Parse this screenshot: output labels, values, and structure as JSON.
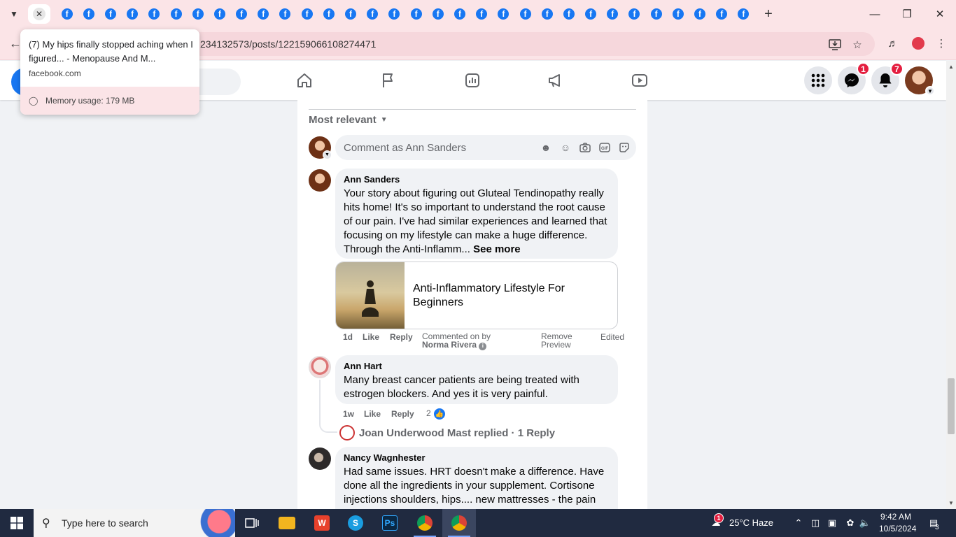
{
  "browser": {
    "tab_count_facebook": 32,
    "hovercard": {
      "title": "(7) My hips finally stopped aching when I figured... - Menopause And M...",
      "domain": "facebook.com",
      "memory": "Memory usage: 179 MB"
    },
    "url": "234132573/posts/122159066108274471"
  },
  "fb": {
    "messenger_badge": "1",
    "notifications_badge": "7"
  },
  "comments": {
    "sort_label": "Most relevant",
    "input_placeholder": "Comment as Ann Sanders",
    "items": [
      {
        "author": "Ann Sanders",
        "text": "Your story about figuring out Gluteal Tendinopathy really hits home! It's so important to understand the root cause of our pain. I've had similar experiences and learned that focusing on my lifestyle can make a huge difference. Through the Anti-Inflamm...",
        "see_more": "See more",
        "link_title": "Anti-Inflammatory Lifestyle For Beginners",
        "time": "1d",
        "like": "Like",
        "reply": "Reply",
        "commented_on_by": "Commented on by",
        "commented_on_by_name": "Norma Rivera",
        "remove_preview_1": "Remove",
        "remove_preview_2": "Preview",
        "edited": "Edited"
      },
      {
        "author": "Ann Hart",
        "text": "Many breast cancer patients are being treated with estrogen blockers. And yes it is very painful.",
        "time": "1w",
        "like": "Like",
        "reply": "Reply",
        "reactions": "2",
        "replied_text": "Joan Underwood Mast replied · 1 Reply"
      },
      {
        "author": "Nancy Wagnhester",
        "text": "Had same issues. HRT doesn't make a difference. Have done all the ingredients in your supplement. Cortisone injections shoulders, hips.... new mattresses - the pain"
      }
    ]
  },
  "taskbar": {
    "search_placeholder": "Type here to search",
    "weather_badge": "1",
    "weather": "25°C  Haze",
    "time": "9:42 AM",
    "date": "10/5/2024",
    "notif_count": "3"
  },
  "colors": {
    "fb_blue": "#1877f2",
    "browser_chrome": "#fbe4e7",
    "badge_red": "#e41e3f",
    "taskbar": "#202a40"
  }
}
